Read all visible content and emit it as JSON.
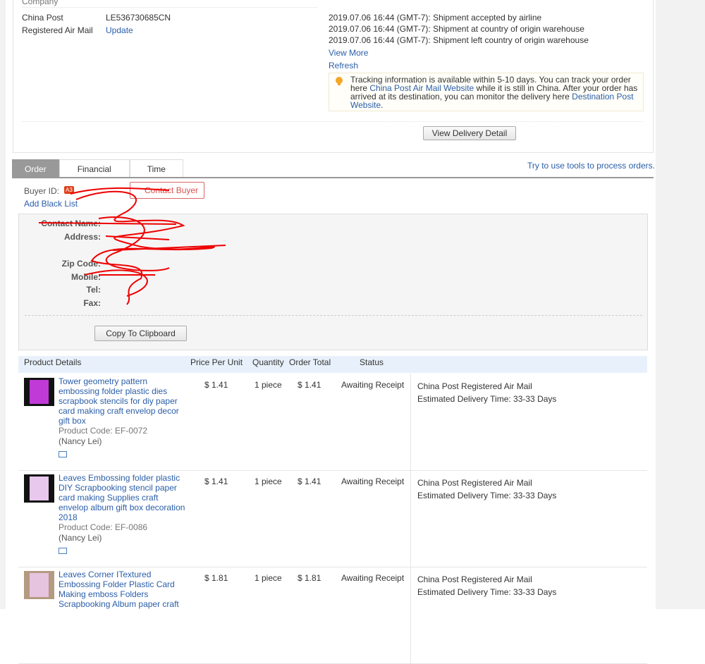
{
  "shipping": {
    "company_label": "Company",
    "carrier_name": "China Post",
    "carrier_service": "Registered Air Mail",
    "tracking_number": "LE536730685CN",
    "update_link": "Update",
    "events": [
      "2019.07.06 16:44 (GMT-7): Shipment accepted by airline",
      "2019.07.06 16:44 (GMT-7): Shipment at country of origin warehouse",
      "2019.07.06 16:44 (GMT-7): Shipment left country of origin warehouse"
    ],
    "view_more": "View More",
    "refresh": "Refresh",
    "tip": {
      "t1": "Tracking information is available within 5-10 days. You can track your order here ",
      "link1": "China Post Air Mail Website",
      "t2": " while it is still in China. After your order has arrived at its destination, you can monitor the delivery here ",
      "link2": "Destination Post Website",
      "t3": "."
    },
    "view_delivery_button": "View Delivery Detail"
  },
  "tabs": [
    "Order",
    "Financial",
    "Time"
  ],
  "tools_link": "Try to use tools to process orders.",
  "buyer": {
    "id_label": "Buyer ID:",
    "badge": "A3",
    "contact_button": "Contact Buyer",
    "add_blacklist": "Add Black List"
  },
  "contact": {
    "labels": [
      "Contact Name:",
      "Address:",
      "Zip Code:",
      "Mobile:",
      "Tel:",
      "Fax:"
    ],
    "copy_button": "Copy To Clipboard"
  },
  "table": {
    "headers": [
      "Product Details",
      "Price Per Unit",
      "Quantity",
      "Order Total",
      "Status"
    ],
    "rows": [
      {
        "title": "Tower geometry pattern embossing folder plastic dies scrapbook stencils for diy paper card making craft envelop decor gift box",
        "code": "Product Code: EF-0072",
        "seller": "(Nancy Lei)",
        "price": "$ 1.41",
        "qty": "1 piece",
        "total": "$ 1.41",
        "status": "Awaiting Receipt",
        "ship": "China Post Registered Air Mail",
        "eta": "Estimated Delivery Time: 33-33 Days",
        "thumb_color": "#c03ad8"
      },
      {
        "title": "Leaves Embossing folder plastic DIY Scrapbooking stencil paper card making Supplies craft envelop album gift box decoration 2018",
        "code": "Product Code: EF-0086",
        "seller": "(Nancy Lei)",
        "price": "$ 1.41",
        "qty": "1 piece",
        "total": "$ 1.41",
        "status": "Awaiting Receipt",
        "ship": "China Post Registered Air Mail",
        "eta": "Estimated Delivery Time: 33-33 Days",
        "thumb_color": "#e8c8ec"
      },
      {
        "title": "Leaves Corner ITextured Embossing Folder Plastic Card Making emboss Folders Scrapbooking Album paper craft",
        "price": "$ 1.81",
        "qty": "1 piece",
        "total": "$ 1.81",
        "status": "Awaiting Receipt",
        "ship": "China Post Registered Air Mail",
        "eta": "Estimated Delivery Time: 33-33 Days",
        "thumb_color": "#e6c4e0"
      }
    ]
  },
  "colors": {
    "link": "#2a5ea8",
    "tab_active": "#999999",
    "header_bg": "#e8f1fb",
    "redaction": "#e00000"
  }
}
